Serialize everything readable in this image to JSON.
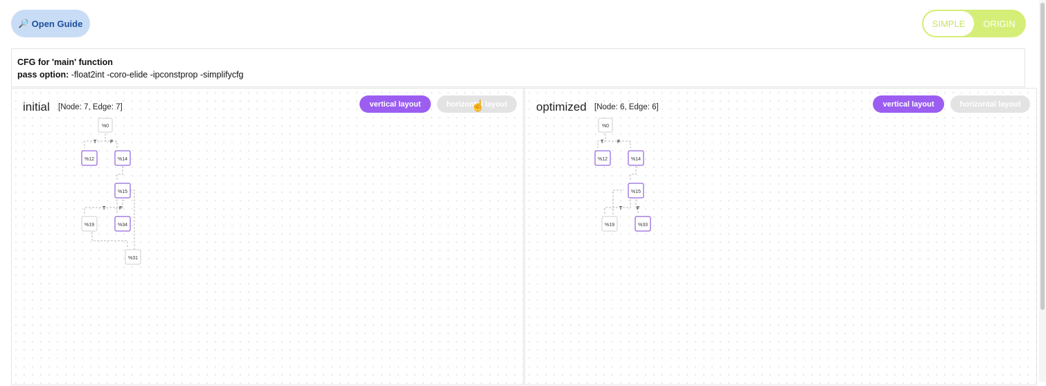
{
  "header": {
    "guide_label": "Open Guide",
    "toggle": {
      "simple_label": "SIMPLE",
      "origin_label": "ORIGIN"
    }
  },
  "info": {
    "title": "CFG for 'main' function",
    "pass_prefix": "pass option:",
    "pass_value": " -float2int -coro-elide -ipconstprop -simplifycfg"
  },
  "panels": [
    {
      "title": "initial",
      "stats": "[Node: 7, Edge: 7]",
      "vertical_label": "vertical layout",
      "horizontal_label": "horizontal layout",
      "nodes": [
        {
          "label": "%0",
          "highlighted": false
        },
        {
          "label": "%12",
          "highlighted": true
        },
        {
          "label": "%14",
          "highlighted": true
        },
        {
          "label": "%15",
          "highlighted": true
        },
        {
          "label": "%19",
          "highlighted": false
        },
        {
          "label": "%34",
          "highlighted": true
        },
        {
          "label": "%31",
          "highlighted": false
        }
      ],
      "edge_labels": [
        "T",
        "F",
        "T",
        "F"
      ]
    },
    {
      "title": "optimized",
      "stats": "[Node: 6, Edge: 6]",
      "vertical_label": "vertical layout",
      "horizontal_label": "horizontal layout",
      "nodes": [
        {
          "label": "%0",
          "highlighted": false
        },
        {
          "label": "%12",
          "highlighted": true
        },
        {
          "label": "%14",
          "highlighted": true
        },
        {
          "label": "%15",
          "highlighted": true
        },
        {
          "label": "%19",
          "highlighted": false
        },
        {
          "label": "%33",
          "highlighted": true
        }
      ],
      "edge_labels": [
        "T",
        "F",
        "T",
        "F"
      ]
    }
  ]
}
